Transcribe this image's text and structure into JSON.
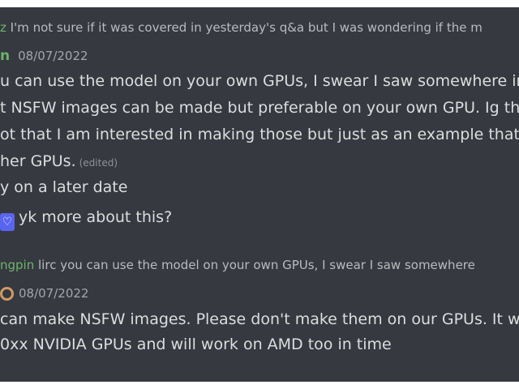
{
  "reply1": {
    "name": "z",
    "text": "I'm not sure if it was covered in yesterday's q&a but I was wondering if the m"
  },
  "header1": {
    "author": "n",
    "timestamp": "08/07/2022"
  },
  "message1": {
    "lines": [
      "u can use the model on your own GPUs,  I swear  I saw somewhere in",
      "t NSFW images can be made but preferable on your own GPU. Ig tha",
      "ot that I am interested in making those but just as an example that yo",
      "her GPUs."
    ],
    "edited": "(edited)"
  },
  "message2": {
    "text": "y on a later date"
  },
  "message3": {
    "emoji": "heart-emoji",
    "text": "yk more about this?"
  },
  "reply2": {
    "name": "ngpin",
    "text": "lirc you can use the model on your own GPUs,  I swear  I saw somewhere"
  },
  "header2": {
    "timestamp": "08/07/2022"
  },
  "message4": {
    "lines": [
      "can make NSFW images. Please don't make them on our GPUs. It wo",
      "0xx NVIDIA GPUs and will work on AMD too in time"
    ]
  },
  "colors": {
    "background": "#36393f",
    "text": "#dcddde",
    "username": "#6db36d",
    "timestamp": "#a3a6aa",
    "emoji_bg": "#5865f2"
  }
}
